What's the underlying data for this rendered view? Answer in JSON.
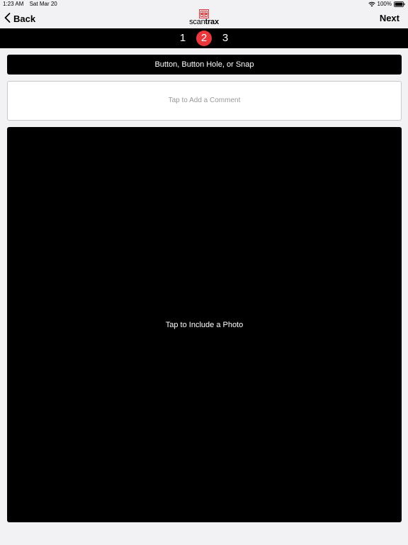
{
  "status_bar": {
    "time": "1:23 AM",
    "date": "Sat Mar 20",
    "battery": "100%",
    "icons": [
      "wifi-icon",
      "battery-icon"
    ]
  },
  "nav": {
    "back_label": "Back",
    "next_label": "Next",
    "logo_text_regular": "scan",
    "logo_text_bold": "trax",
    "icons": [
      "chevron-left-icon",
      "scantrax-logo-icon"
    ]
  },
  "stepper": {
    "steps": [
      "1",
      "2",
      "3"
    ],
    "active_step": "2"
  },
  "category": {
    "label": "Button, Button Hole, or Snap"
  },
  "comment": {
    "placeholder": "Tap to Add a Comment"
  },
  "photo": {
    "label": "Tap to Include a Photo"
  },
  "colors": {
    "accent": "#e8383d",
    "background": "#f2f2f4",
    "bar": "#000000"
  }
}
